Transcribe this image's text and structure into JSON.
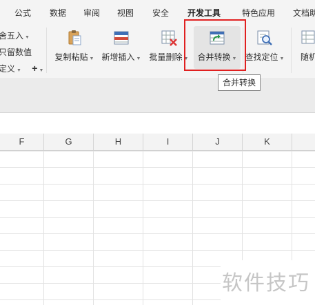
{
  "menu": {
    "tabs": [
      {
        "label": "公式"
      },
      {
        "label": "数据"
      },
      {
        "label": "审阅"
      },
      {
        "label": "视图"
      },
      {
        "label": "安全"
      },
      {
        "label": "开发工具"
      },
      {
        "label": "特色应用"
      },
      {
        "label": "文档助"
      }
    ]
  },
  "ribbon": {
    "left_group": {
      "round_label": "舍五入",
      "keep_value_label": "只留数值",
      "custom_label": "定义",
      "plus_symbol": "+"
    },
    "buttons": [
      {
        "label": "复制粘贴",
        "icon": "clipboard-icon"
      },
      {
        "label": "新增插入",
        "icon": "insert-table-icon"
      },
      {
        "label": "批量删除",
        "icon": "delete-table-icon"
      },
      {
        "label": "合并转换",
        "icon": "merge-convert-icon"
      },
      {
        "label": "查找定位",
        "icon": "find-locate-icon"
      },
      {
        "label": "随机",
        "icon": "random-icon"
      }
    ],
    "tooltip": "合并转换"
  },
  "sheet": {
    "columns": [
      "F",
      "G",
      "H",
      "I",
      "J",
      "K"
    ]
  },
  "watermark": "软件技巧",
  "colors": {
    "highlight_border": "#e02020",
    "ribbon_bg": "#f4f4f4",
    "grid_line": "#e2e2e2"
  }
}
